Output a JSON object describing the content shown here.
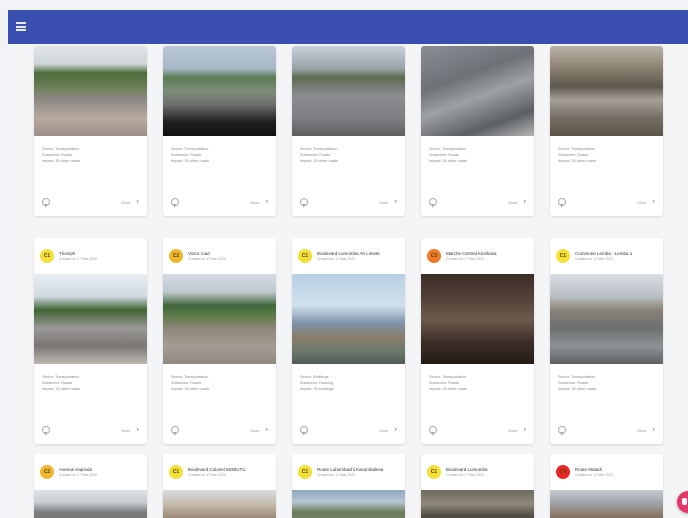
{
  "appbar": {
    "color": "#3a4fb0",
    "menu_icon": "menu-icon"
  },
  "rows": [
    {
      "has_header": false,
      "cards": [
        {
          "title": "",
          "subtitle": "",
          "sector": "Sector: Transportation",
          "subsector": "Subsector: Roads",
          "impact": "Impact: 30 other roads",
          "action": "More",
          "photo": "flooded-road-with-taxi"
        },
        {
          "title": "",
          "subtitle": "",
          "sector": "Sector: Transportation",
          "subsector": "Subsector: Roads",
          "impact": "Impact: 30 other roads",
          "action": "More",
          "photo": "road-view-through-windshield"
        },
        {
          "title": "",
          "subtitle": "",
          "sector": "Sector: Transportation",
          "subsector": "Subsector: Roads",
          "impact": "Impact: 30 other roads",
          "action": "More",
          "photo": "boulevard-with-white-pickup"
        },
        {
          "title": "",
          "subtitle": "",
          "sector": "Sector: Transportation",
          "subsector": "Subsector: Roads",
          "impact": "Impact: 30 other roads",
          "action": "More",
          "photo": "damaged-road-surface"
        },
        {
          "title": "",
          "subtitle": "",
          "sector": "Sector: Transportation",
          "subsector": "Subsector: Roads",
          "impact": "Impact: 30 other roads",
          "action": "More",
          "photo": "eroded-gully-road"
        }
      ]
    },
    {
      "has_header": true,
      "cards": [
        {
          "avatar": "C1",
          "avatar_color": "#f5e03a",
          "title": "Triumph",
          "subtitle": "Created on 17 Mar 2020",
          "sector": "Sector: Transportation",
          "subsector": "Subsector: Roads",
          "impact": "Impact: 30 other roads",
          "action": "More",
          "photo": "avenue-with-billboard"
        },
        {
          "avatar": "C2",
          "avatar_color": "#f0b62e",
          "title": "Victor road",
          "subtitle": "Created on 17 Mar 2020",
          "sector": "Sector: Transportation",
          "subsector": "Subsector: Roads",
          "impact": "Impact: 30 other roads",
          "action": "More",
          "photo": "wide-dirt-road"
        },
        {
          "avatar": "C1",
          "avatar_color": "#f5e03a",
          "title": "Boulevard Lumumba Ah Limete",
          "subtitle": "Created on 17 Mar 2020",
          "sector": "Sector: Buildings",
          "subsector": "Subsector: Housing",
          "impact": "Impact: 30 buildings",
          "action": "More",
          "photo": "arch-monument-square"
        },
        {
          "avatar": "C3",
          "avatar_color": "#f07a26",
          "title": "Marche Central Kinshasa",
          "subtitle": "Created on 17 Mar 2020",
          "sector": "Sector: Transportation",
          "subsector": "Subsector: Roads",
          "impact": "Impact: 30 other roads",
          "action": "More",
          "photo": "dark-market-interior"
        },
        {
          "avatar": "C1",
          "avatar_color": "#f5e03a",
          "title": "Commune Lemba - Lemba 1",
          "subtitle": "Created on 17 Mar 2020",
          "sector": "Sector: Transportation",
          "subsector": "Subsector: Roads",
          "impact": "Impact: 30 other roads",
          "action": "More",
          "photo": "street-with-parked-cars"
        }
      ]
    },
    {
      "has_header": true,
      "cards": [
        {
          "avatar": "C2",
          "avatar_color": "#f0b62e",
          "title": "Avenue Kapinda",
          "subtitle": "Created on 17 Mar 2020",
          "photo": "paved-road"
        },
        {
          "avatar": "C1",
          "avatar_color": "#f5e03a",
          "title": "Boulevard Colonel MOBUTU",
          "subtitle": "Created on 17 Mar 2020",
          "photo": "street-with-buildings"
        },
        {
          "avatar": "C1",
          "avatar_color": "#f5e03a",
          "title": "Route Lubumbashi Kasumbalesa",
          "subtitle": "Created on 17 Mar 2020",
          "photo": "highway-landscape"
        },
        {
          "avatar": "C1",
          "avatar_color": "#f5e03a",
          "title": "Boulevard Lumumba",
          "subtitle": "Created on 17 Mar 2020",
          "photo": "collapsed-road"
        },
        {
          "avatar": "C4",
          "avatar_color": "#e8272a",
          "title": "Route Matadi",
          "subtitle": "Created on 17 Mar 2020",
          "photo": "street-with-shops"
        }
      ]
    }
  ],
  "fab": {
    "color": "#e23a68",
    "icon": "chat-icon"
  }
}
